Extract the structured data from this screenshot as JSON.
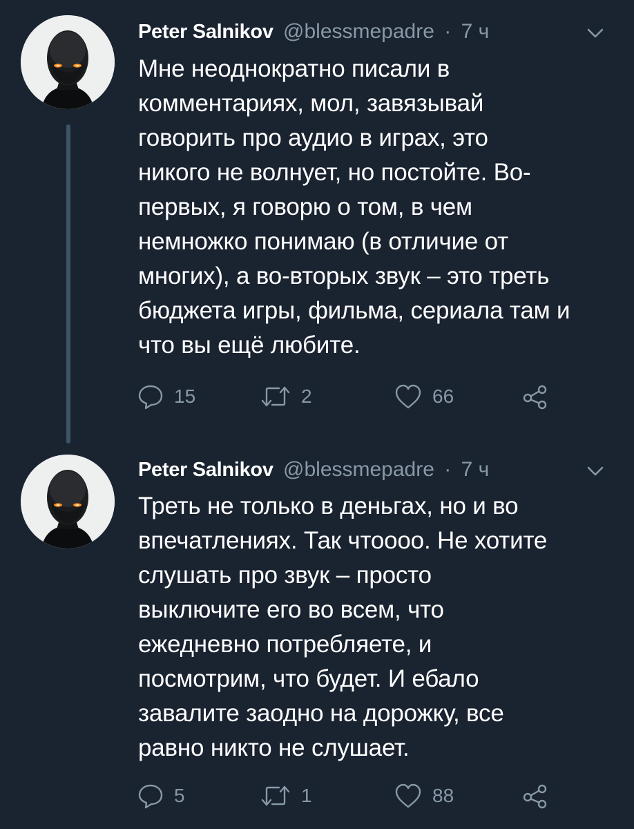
{
  "tweets": [
    {
      "author": "Peter Salnikov",
      "handle": "@blessmepadre",
      "separator": "·",
      "time": "7 ч",
      "text": "Мне неоднократно писали в\nкомментариях, мол, завязывай\nговорить про аудио в играх, это\nникого не волнует, но постойте. Во-\nпервых, я говорю о том, в чем\nнемножко понимаю (в отличие от\nмногих), а во-вторых звук – это треть\nбюджета игры, фильма, сериала там и\nчто вы ещё любите.",
      "replies": "15",
      "retweets": "2",
      "likes": "66"
    },
    {
      "author": "Peter Salnikov",
      "handle": "@blessmepadre",
      "separator": "·",
      "time": "7 ч",
      "text": "Треть не только в деньгах, но и во\nвпечатлениях. Так чтоооо. Не хотите\nслушать про звук – просто\nвыключите его во всем, что\nежедневно потребляете, и\nпосмотрим, что будет. И ебало\nзавалите заодно на дорожку, все\nравно никто не слушает.",
      "replies": "5",
      "retweets": "1",
      "likes": "88"
    }
  ],
  "icons": {
    "reply": "reply-icon",
    "retweet": "retweet-icon",
    "like": "heart-icon",
    "share": "share-icon",
    "menu": "chevron-down-icon"
  },
  "colors": {
    "background": "#1a2330",
    "text": "#ffffff",
    "muted": "#8899a6",
    "thread_line": "#3d5466",
    "avatar_bg": "#eef0ef",
    "eyes": "#ff8a1c"
  }
}
